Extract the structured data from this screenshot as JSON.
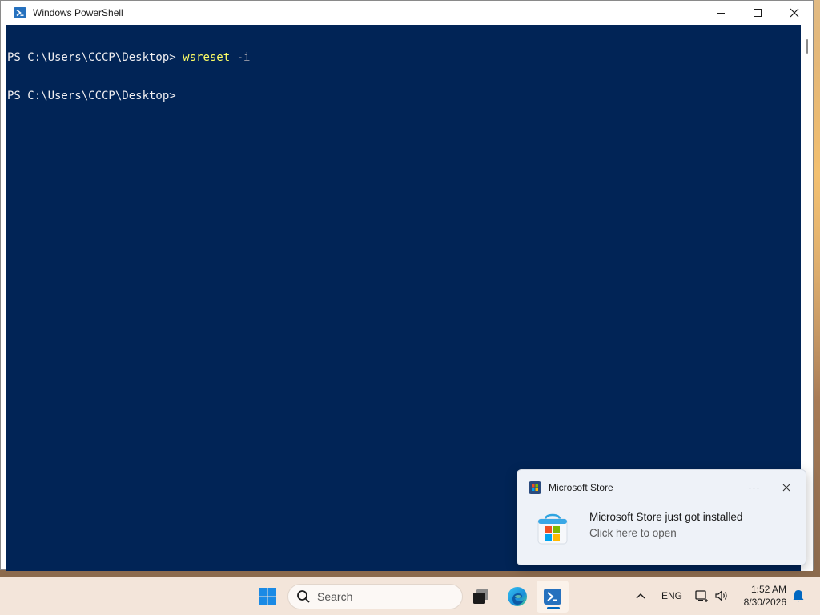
{
  "window": {
    "title": "Windows PowerShell",
    "icon": "powershell-icon",
    "controls": [
      "minimize-icon",
      "maximize-icon",
      "close-icon"
    ]
  },
  "console": {
    "line1": {
      "prompt": "PS C:\\Users\\CCCP\\Desktop> ",
      "command": "wsreset",
      "param": " -i"
    },
    "line2": {
      "prompt": "PS C:\\Users\\CCCP\\Desktop> "
    },
    "background": "#012456"
  },
  "toast": {
    "app_name": "Microsoft Store",
    "more": "···",
    "title": "Microsoft Store just got installed",
    "subtitle": "Click here to open",
    "icon": "microsoft-store-icon"
  },
  "taskbar": {
    "search_placeholder": "Search",
    "language": "ENG",
    "time": "1:52 AM",
    "date": "8/30/2026",
    "items": [
      "windows-start-icon",
      "search-icon",
      "task-view-icon",
      "edge-icon",
      "powershell-icon"
    ],
    "accent": "#0067c0"
  }
}
